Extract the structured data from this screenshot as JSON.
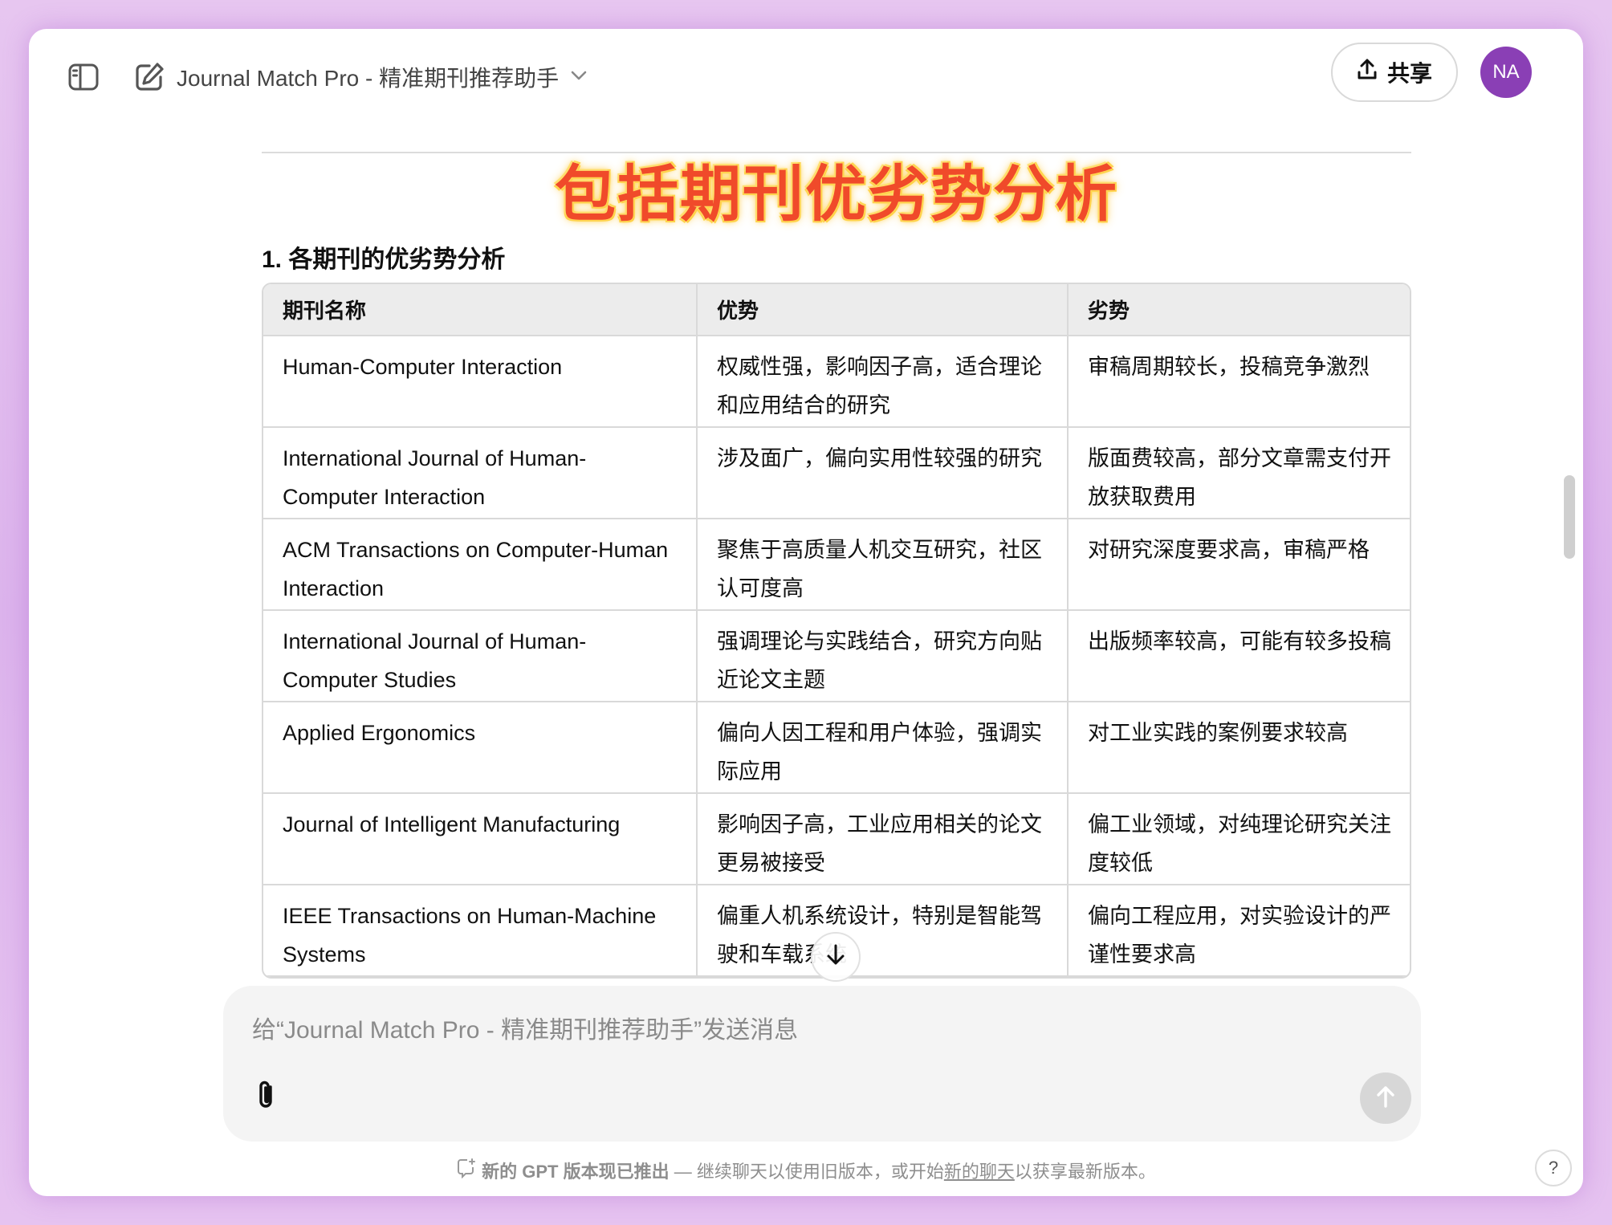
{
  "header": {
    "title": "Journal Match Pro - 精准期刊推荐助手",
    "share_label": "共享",
    "avatar_initials": "NA"
  },
  "banner": "包括期刊优劣势分析",
  "section_heading": "1. 各期刊的优劣势分析",
  "table": {
    "headers": [
      "期刊名称",
      "优势",
      "劣势"
    ],
    "rows": [
      [
        "Human-Computer Interaction",
        "权威性强，影响因子高，适合理论和应用结合的研究",
        "审稿周期较长，投稿竞争激烈"
      ],
      [
        "International Journal of Human-Computer Interaction",
        "涉及面广，偏向实用性较强的研究",
        "版面费较高，部分文章需支付开放获取费用"
      ],
      [
        "ACM Transactions on Computer-Human Interaction",
        "聚焦于高质量人机交互研究，社区认可度高",
        "对研究深度要求高，审稿严格"
      ],
      [
        "International Journal of Human-Computer Studies",
        "强调理论与实践结合，研究方向贴近论文主题",
        "出版频率较高，可能有较多投稿"
      ],
      [
        "Applied Ergonomics",
        "偏向人因工程和用户体验，强调实际应用",
        "对工业实践的案例要求较高"
      ],
      [
        "Journal of Intelligent Manufacturing",
        "影响因子高，工业应用相关的论文更易被接受",
        "偏工业领域，对纯理论研究关注度较低"
      ],
      [
        "IEEE Transactions on Human-Machine Systems",
        "偏重人机系统设计，特别是智能驾驶和车载系统",
        "偏向工程应用，对实验设计的严谨性要求高"
      ]
    ]
  },
  "composer": {
    "placeholder": "给“Journal Match Pro - 精准期刊推荐助手”发送消息"
  },
  "notice": {
    "bold": "新的 GPT 版本现已推出",
    "text_before": " — 继续聊天以使用旧版本，或开始",
    "link": "新的聊天",
    "text_after": "以获享最新版本。"
  },
  "help_label": "?",
  "icons": {
    "sidebar": "sidebar-toggle-icon",
    "new_chat": "edit-icon",
    "share": "upload-icon",
    "scroll_down": "arrow-down-icon",
    "attach": "paperclip-icon",
    "send": "arrow-up-icon"
  },
  "colors": {
    "avatar": "#8a3fb5",
    "banner_text": "#f04a2a",
    "banner_glow": "#ffd54d"
  }
}
